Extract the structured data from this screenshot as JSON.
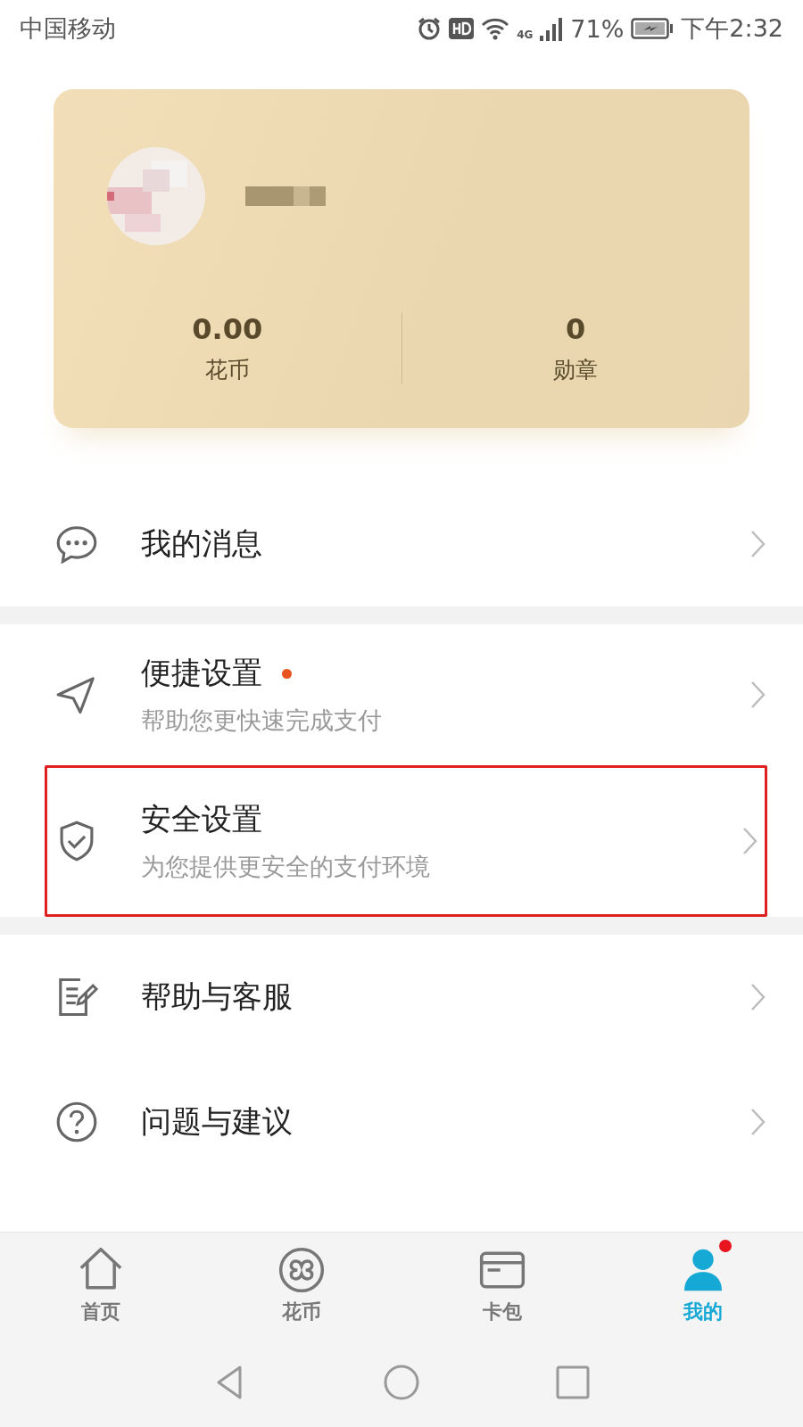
{
  "status_bar": {
    "carrier": "中国移动",
    "network": "4G",
    "battery": "71%",
    "time": "下午2:32"
  },
  "profile": {
    "stats": [
      {
        "value": "0.00",
        "label": "花币"
      },
      {
        "value": "0",
        "label": "勋章"
      }
    ]
  },
  "sections": [
    {
      "items": [
        {
          "title": "我的消息",
          "dot": false,
          "highlighted": false
        }
      ]
    },
    {
      "items": [
        {
          "title": "便捷设置",
          "subtitle": "帮助您更快速完成支付",
          "dot": true,
          "highlighted": false
        },
        {
          "title": "安全设置",
          "subtitle": "为您提供更安全的支付环境",
          "dot": false,
          "highlighted": true
        }
      ]
    },
    {
      "items": [
        {
          "title": "帮助与客服",
          "dot": false,
          "highlighted": false
        },
        {
          "title": "问题与建议",
          "dot": false,
          "highlighted": false
        }
      ]
    }
  ],
  "tab_bar": {
    "tabs": [
      {
        "label": "首页",
        "selected": false,
        "dot": false
      },
      {
        "label": "花币",
        "selected": false,
        "dot": false
      },
      {
        "label": "卡包",
        "selected": false,
        "dot": false
      },
      {
        "label": "我的",
        "selected": true,
        "dot": true
      }
    ]
  }
}
